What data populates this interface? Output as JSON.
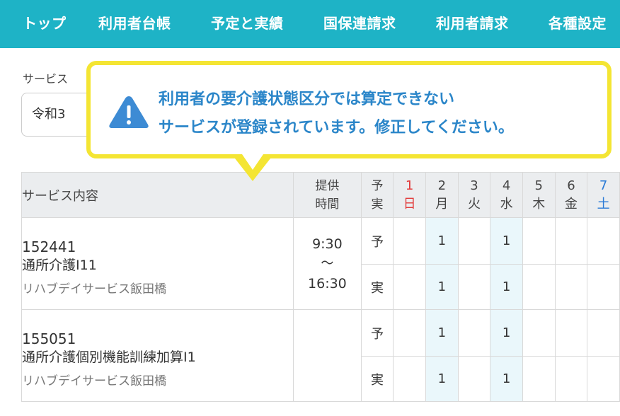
{
  "nav": {
    "items": [
      "トップ",
      "利用者台帳",
      "予定と実績",
      "国保連請求",
      "利用者請求",
      "各種設定"
    ]
  },
  "filter": {
    "service_label": "サービス",
    "period_value": "令和3"
  },
  "warning": {
    "line1": "利用者の要介護状態区分では算定できない",
    "line2": "サービスが登録されています。修正してください。",
    "icon": "warning-triangle-icon",
    "border_color": "#f4e533",
    "text_color": "#2b86c9"
  },
  "table": {
    "headers": {
      "content": "サービス内容",
      "time_line1": "提供",
      "time_line2": "時間",
      "yj_line1": "予",
      "yj_line2": "実"
    },
    "days": [
      {
        "num": "1",
        "dow": "日",
        "type": "sun"
      },
      {
        "num": "2",
        "dow": "月",
        "type": ""
      },
      {
        "num": "3",
        "dow": "火",
        "type": ""
      },
      {
        "num": "4",
        "dow": "水",
        "type": ""
      },
      {
        "num": "5",
        "dow": "木",
        "type": ""
      },
      {
        "num": "6",
        "dow": "金",
        "type": ""
      },
      {
        "num": "7",
        "dow": "土",
        "type": "sat"
      }
    ],
    "plan_label": "予",
    "actual_label": "実",
    "services": [
      {
        "code": "152441",
        "name": "通所介護Ⅰ11",
        "facility": "リハブデイサービス飯田橋",
        "time_start": "9:30",
        "time_sep": "〜",
        "time_end": "16:30",
        "plan": [
          "",
          "1",
          "",
          "1",
          "",
          "",
          ""
        ],
        "actual": [
          "",
          "1",
          "",
          "1",
          "",
          "",
          ""
        ]
      },
      {
        "code": "155051",
        "name": "通所介護個別機能訓練加算Ⅰ1",
        "facility": "リハブデイサービス飯田橋",
        "time_start": "",
        "time_sep": "",
        "time_end": "",
        "plan": [
          "",
          "1",
          "",
          "1",
          "",
          "",
          ""
        ],
        "actual": [
          "",
          "1",
          "",
          "1",
          "",
          "",
          ""
        ]
      }
    ]
  },
  "colors": {
    "nav_bg": "#1eb3c6",
    "header_bg": "#ebedef",
    "highlight_col": "#eaf7fb",
    "sunday": "#e23b3b",
    "saturday": "#2b7bd6"
  }
}
